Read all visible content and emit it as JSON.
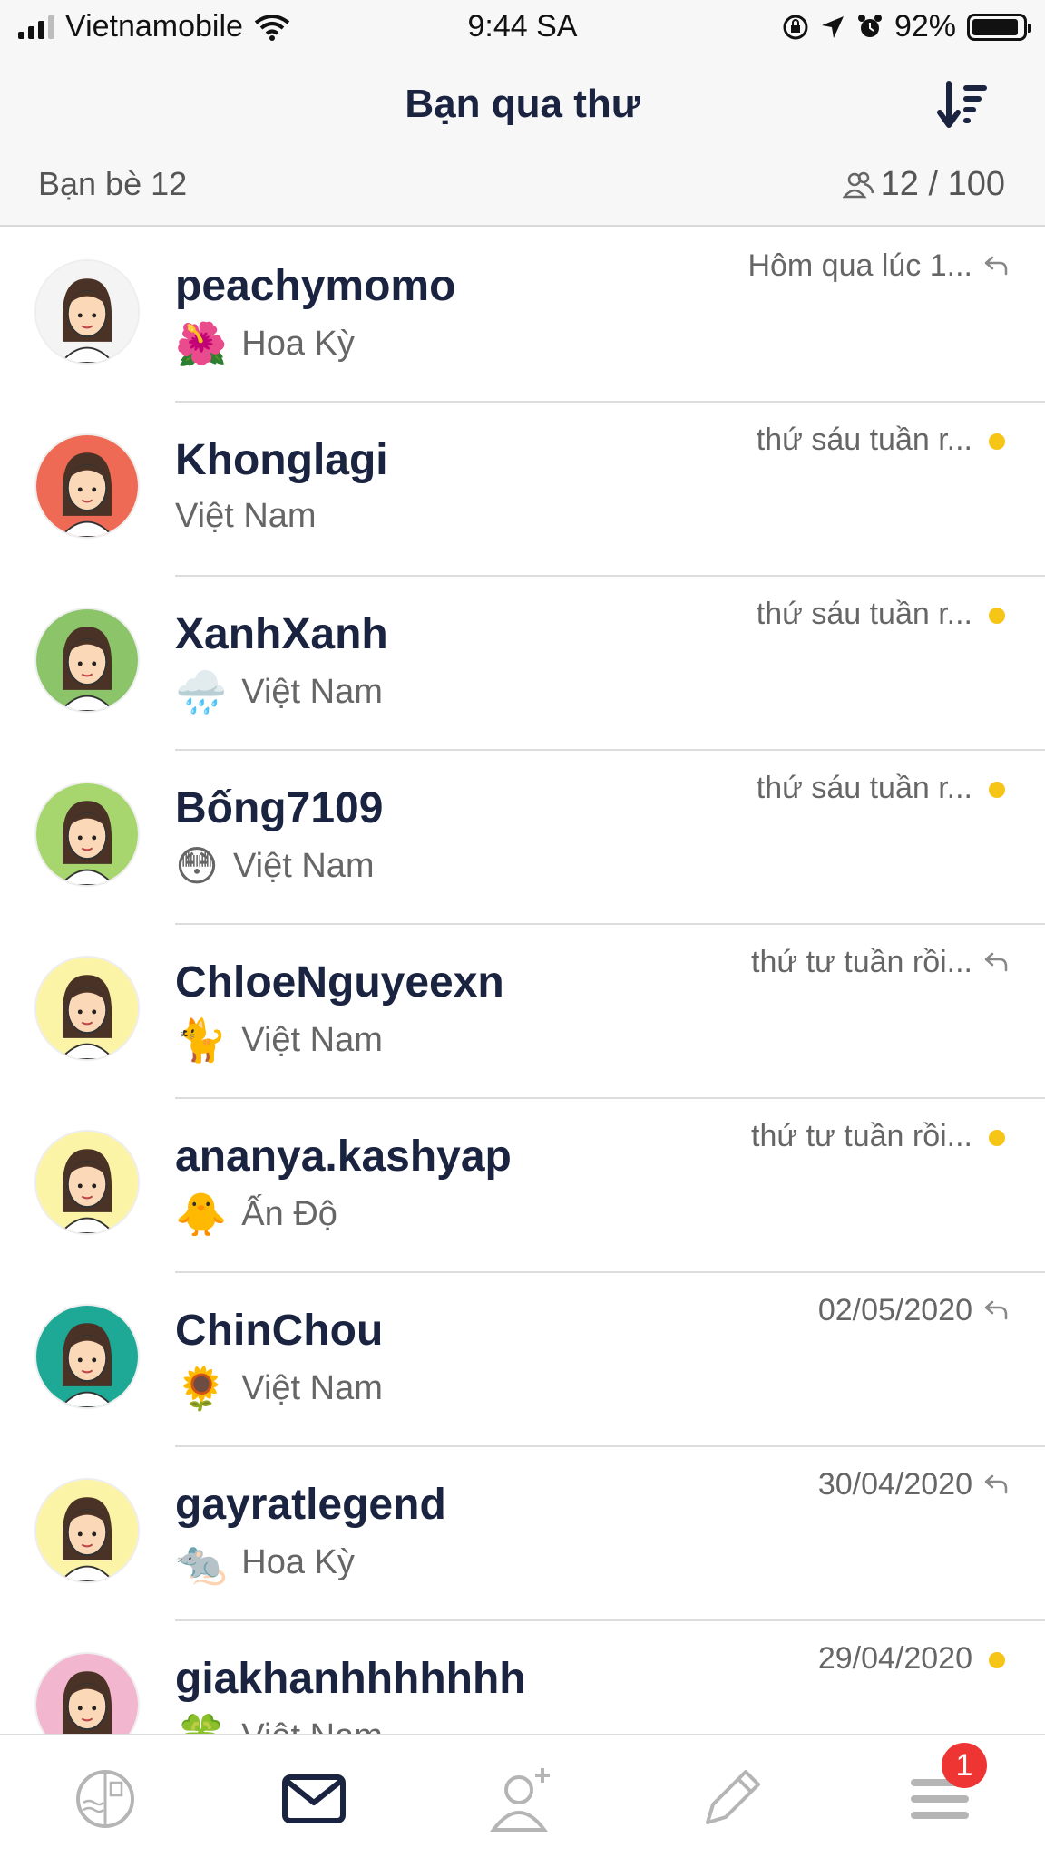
{
  "status_bar": {
    "carrier": "Vietnamobile",
    "time": "9:44 SA",
    "battery": "92%"
  },
  "header": {
    "title": "Bạn qua thư",
    "friends_label": "Bạn bè 12",
    "capacity": "12 / 100"
  },
  "friends": [
    {
      "name": "peachymomo",
      "flag": "🌺",
      "country": "Hoa Kỳ",
      "time": "Hôm qua lúc 1...",
      "status": "replied",
      "avatar_bg": "#f4f4f4"
    },
    {
      "name": "Khonglagi",
      "flag": "",
      "country": "Việt Nam",
      "time": "thứ sáu tuần r...",
      "status": "unread",
      "avatar_bg": "#ee6a55"
    },
    {
      "name": "XanhXanh",
      "flag": "🌧️",
      "country": "Việt Nam",
      "time": "thứ sáu tuần r...",
      "status": "unread",
      "avatar_bg": "#8cc46a"
    },
    {
      "name": "Bống7109",
      "flag": "😳",
      "country": "Việt Nam",
      "time": "thứ sáu tuần r...",
      "status": "unread",
      "avatar_bg": "#a8d66e"
    },
    {
      "name": "ChloeNguyeexn",
      "flag": "🐈",
      "country": "Việt Nam",
      "time": "thứ tư tuần rồi...",
      "status": "replied",
      "avatar_bg": "#fbf3a6"
    },
    {
      "name": "ananya.kashyap",
      "flag": "🐥",
      "country": "Ấn Độ",
      "time": "thứ tư tuần rồi...",
      "status": "unread",
      "avatar_bg": "#fbf3a6"
    },
    {
      "name": "ChinChou",
      "flag": "🌻",
      "country": "Việt Nam",
      "time": "02/05/2020",
      "status": "replied",
      "avatar_bg": "#1ea896"
    },
    {
      "name": "gayratlegend",
      "flag": "🐀",
      "country": "Hoa Kỳ",
      "time": "30/04/2020",
      "status": "replied",
      "avatar_bg": "#fbf3a6"
    },
    {
      "name": "giakhanhhhhhhh",
      "flag": "🍀",
      "country": "Việt Nam",
      "time": "29/04/2020",
      "status": "unread",
      "avatar_bg": "#f2b6cf"
    }
  ],
  "tabbar": {
    "badge_count": "1",
    "tabs": [
      "stamps-icon",
      "mail-icon",
      "add-friend-icon",
      "write-icon",
      "menu-icon"
    ],
    "active_color": "#1a2340",
    "inactive_color": "#b5b5b5"
  },
  "colors": {
    "unread_dot": "#f5c518",
    "badge": "#ef3434"
  }
}
